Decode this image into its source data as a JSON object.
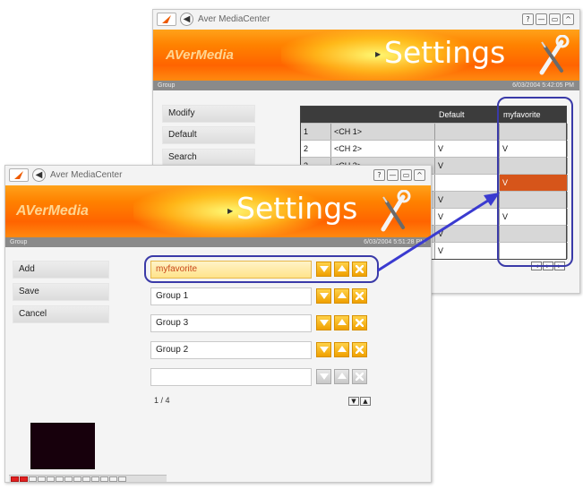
{
  "back_window": {
    "title": "Aver MediaCenter",
    "banner_logo": "AVerMedia",
    "banner_title": "Settings",
    "status_left": "Group",
    "status_right": "6/03/2004 5:42:05 PM",
    "sidebar": [
      {
        "label": "Modify"
      },
      {
        "label": "Default"
      },
      {
        "label": "Search"
      }
    ],
    "table": {
      "headers": {
        "num": "",
        "channel": "",
        "default": "Default",
        "favorite": "myfavorite"
      },
      "rows": [
        {
          "num": "1",
          "channel": "<CH 1>",
          "default": "",
          "favorite": ""
        },
        {
          "num": "2",
          "channel": "<CH 2>",
          "default": "V",
          "favorite": "V"
        },
        {
          "num": "3",
          "channel": "<CH 3>",
          "default": "V",
          "favorite": ""
        },
        {
          "num": "",
          "channel": "",
          "default": "",
          "favorite": "V"
        },
        {
          "num": "",
          "channel": "",
          "default": "V",
          "favorite": ""
        },
        {
          "num": "",
          "channel": "",
          "default": "V",
          "favorite": "V"
        },
        {
          "num": "",
          "channel": "",
          "default": "V",
          "favorite": ""
        },
        {
          "num": "",
          "channel": "",
          "default": "V",
          "favorite": ""
        }
      ]
    }
  },
  "front_window": {
    "title": "Aver MediaCenter",
    "banner_logo": "AVerMedia",
    "banner_title": "Settings",
    "status_left": "Group",
    "status_right": "6/03/2004 5:51:28 PM",
    "sidebar": [
      {
        "label": "Add"
      },
      {
        "label": "Save"
      },
      {
        "label": "Cancel"
      }
    ],
    "groups": [
      {
        "label": "myfavorite"
      },
      {
        "label": "Group 1"
      },
      {
        "label": "Group 3"
      },
      {
        "label": "Group 2"
      },
      {
        "label": ""
      }
    ],
    "pager": "1 / 4"
  },
  "colors": {
    "banner_orange": "#ff7a00",
    "highlight_blue": "#3a3aa8",
    "selected_text": "#c8481a",
    "favorite_cell": "#d6551a"
  },
  "icons": {
    "window_buttons": [
      "?",
      "—",
      "▭",
      "^"
    ],
    "tools": "wrench-screwdriver-icon"
  }
}
